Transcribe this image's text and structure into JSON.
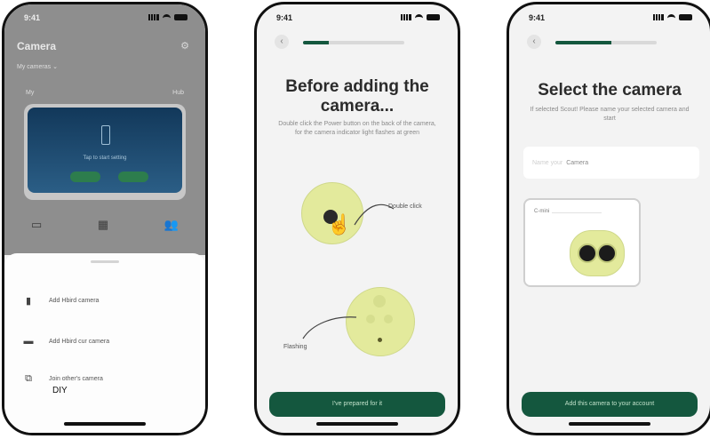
{
  "status": {
    "time": "9:41"
  },
  "screen1": {
    "title": "Camera",
    "settings_icon": "gear-icon",
    "subtitle": "My cameras",
    "col_left": "My",
    "col_right": "Hub",
    "card_text": "Tap to start setting",
    "nav_label": "Shared",
    "options": [
      {
        "icon": "camera-icon",
        "label": "Add Hbird camera"
      },
      {
        "icon": "outdoor-camera-icon",
        "label": "Add Hbird cur camera"
      },
      {
        "icon": "shared-camera-icon",
        "label": "Join other's camera"
      }
    ],
    "diy_label": "DIY"
  },
  "screen2": {
    "progress_percent": 25,
    "title": "Before adding the camera...",
    "description": "Double click the Power button on the back of the camera, for the camera indicator light flashes at green",
    "callout_top": "Double click",
    "callout_bottom": "Flashing",
    "button_label": "I've prepared for it"
  },
  "screen3": {
    "progress_percent": 55,
    "title": "Select the camera",
    "description": "If selected Scout! Please name your selected camera and start",
    "field_label": "Name your",
    "field_value": "Camera",
    "tile_label": "C-mini",
    "button_label": "Add this camera to your account"
  },
  "colors": {
    "accent": "#14573e",
    "device": "#e3ea9c"
  }
}
